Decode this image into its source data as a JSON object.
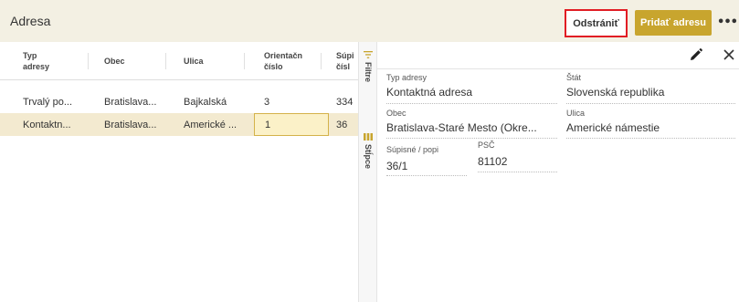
{
  "header": {
    "title": "Adresa",
    "delete_label": "Odstrániť",
    "add_label": "Pridať adresu",
    "more_label": "•••"
  },
  "grid": {
    "columns": [
      {
        "line1": "Typ",
        "line2": "adresy"
      },
      {
        "line1": "Obec",
        "line2": ""
      },
      {
        "line1": "Ulica",
        "line2": ""
      },
      {
        "line1": "Orientačn",
        "line2": "číslo"
      },
      {
        "line1": "Súpi",
        "line2": "čísl"
      }
    ],
    "rows": [
      {
        "cells": [
          "Trvalý po...",
          "Bratislava...",
          "Bajkalská",
          "3",
          "334"
        ],
        "selected": false
      },
      {
        "cells": [
          "Kontaktn...",
          "Bratislava...",
          "Americké ...",
          "1",
          "36"
        ],
        "selected": true
      }
    ]
  },
  "side_strip": {
    "filters_label": "Filtre",
    "columns_label": "Stĺpce"
  },
  "detail": {
    "fields": {
      "type_label": "Typ adresy",
      "type_value": "Kontaktná adresa",
      "state_label": "Štát",
      "state_value": "Slovenská republika",
      "city_label": "Obec",
      "city_value": "Bratislava-Staré Mesto (Okre...",
      "street_label": "Ulica",
      "street_value": "Americké námestie",
      "number_label": "Súpisné / popi",
      "number_value": "36/1",
      "zip_label": "PSČ",
      "zip_value": "81102"
    }
  },
  "colors": {
    "accent": "#c8a52e",
    "topbar_bg": "#f3f0e3",
    "selected_row": "#f3ead0",
    "highlight_border": "#e11d24"
  },
  "icons": [
    "pencil-icon",
    "close-icon",
    "filter-icon",
    "columns-icon",
    "more-icon"
  ]
}
